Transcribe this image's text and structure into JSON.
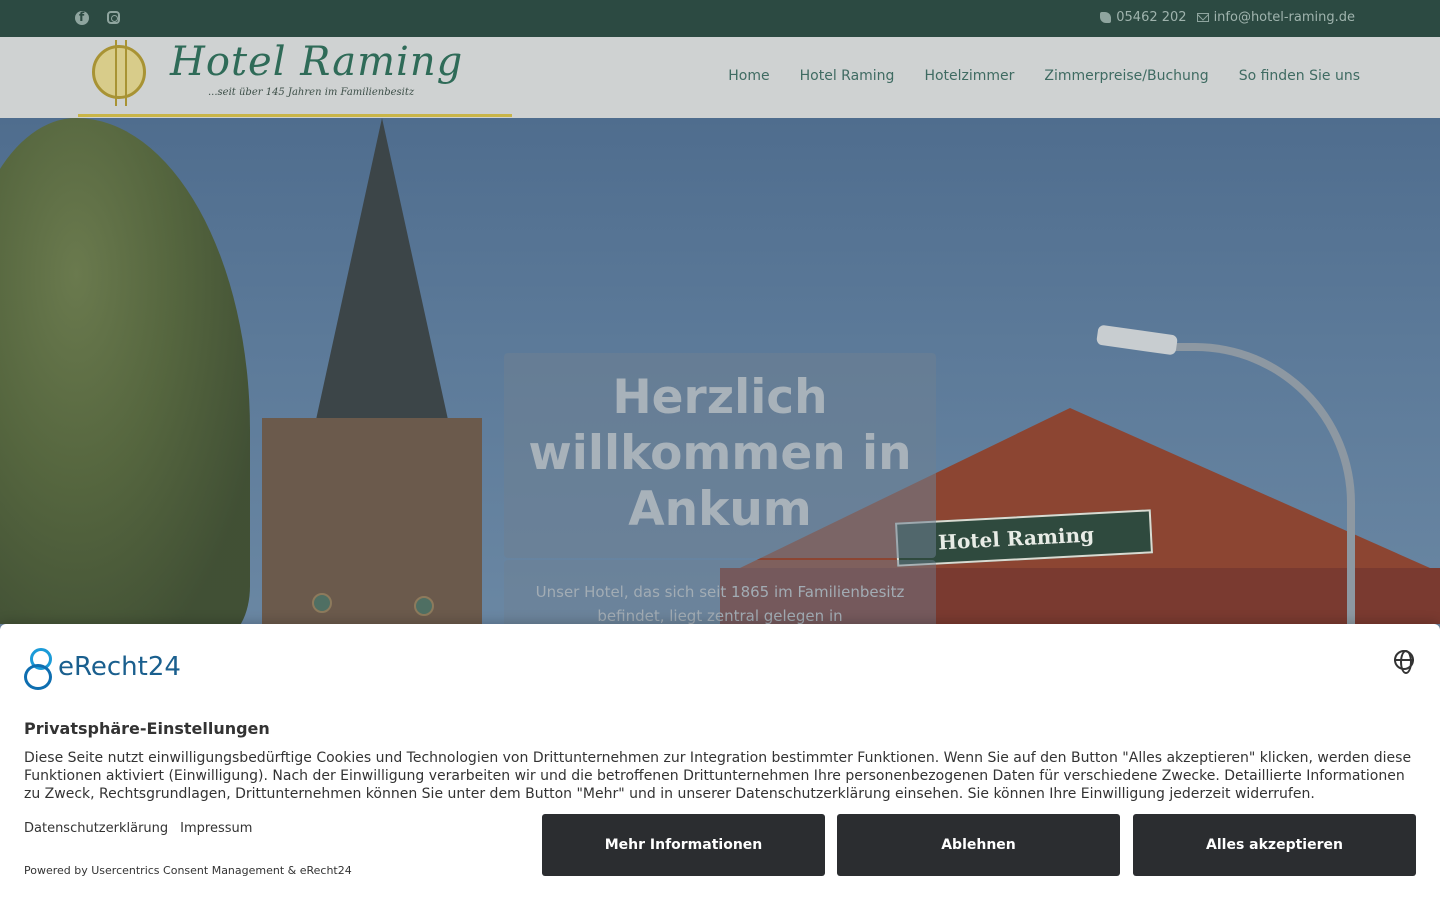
{
  "topbar": {
    "phone": "05462 202",
    "email": "info@hotel-raming.de",
    "icons": [
      "facebook-icon",
      "instagram-icon",
      "phone-icon",
      "mail-icon"
    ]
  },
  "header": {
    "logo_title": "Hotel Raming",
    "logo_tagline": "...seit über 145 Jahren im Familienbesitz",
    "nav": [
      "Home",
      "Hotel Raming",
      "Hotelzimmer",
      "Zimmerpreise/Buchung",
      "So finden Sie uns"
    ]
  },
  "hero": {
    "sign_text": "Hotel Raming",
    "welcome_title": "Herzlich willkommen in Ankum",
    "intro_text": "Unser Hotel, das sich seit 1865 im Familienbesitz befindet, liegt zentral gelegen in"
  },
  "consent": {
    "brand": "eRecht24",
    "title": "Privatsphäre-Einstellungen",
    "text": "Diese Seite nutzt einwilligungsbedürftige Cookies und Technologien von Drittunternehmen zur Integration bestimmter Funktionen. Wenn Sie auf den Button \"Alles akzeptieren\" klicken, werden diese Funktionen aktiviert (Einwilligung). Nach der Einwilligung verarbeiten wir und die betroffenen Drittunternehmen Ihre personenbezogenen Daten für verschiedene Zwecke. Detaillierte Informationen zu Zweck, Rechtsgrundlagen, Drittunternehmen können Sie unter dem Button \"Mehr\" und in unserer Datenschutzerklärung einsehen. Sie können Ihre Einwilligung jederzeit widerrufen.",
    "links": [
      "Datenschutzerklärung",
      "Impressum"
    ],
    "powered": "Powered by Usercentrics Consent Management & eRecht24",
    "buttons": {
      "more": "Mehr Informationen",
      "deny": "Ablehnen",
      "accept": "Alles akzeptieren"
    }
  },
  "colors": {
    "topbar_bg": "#2c4a42",
    "header_bg": "#cfd2d2",
    "nav_text": "#3f6b62",
    "button_bg": "#2b2d30"
  }
}
